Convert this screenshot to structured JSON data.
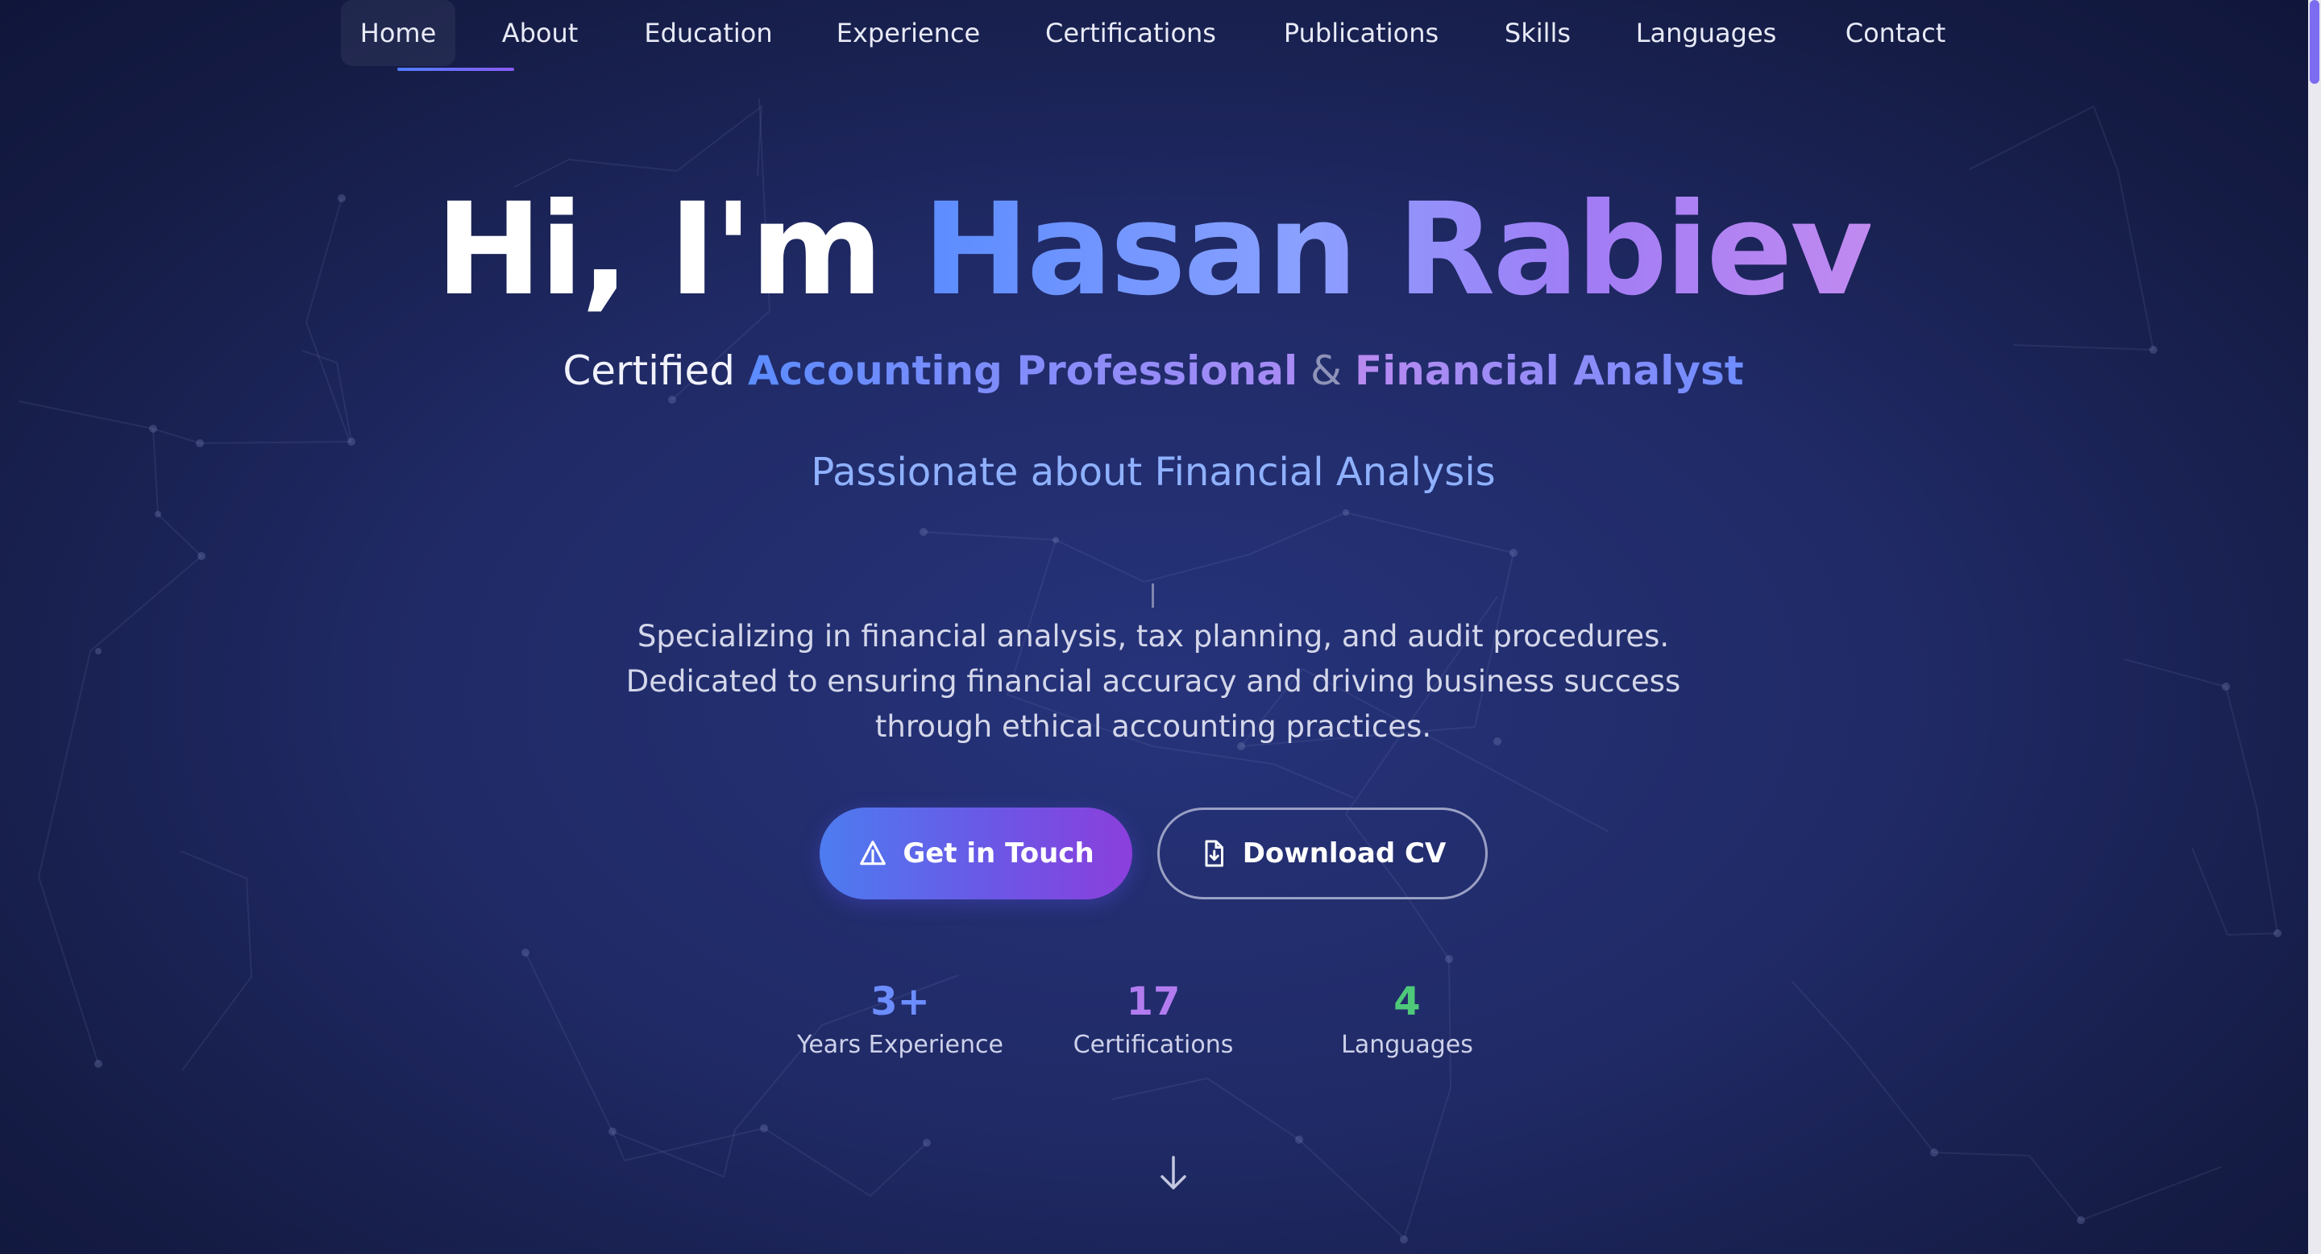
{
  "nav": {
    "items": [
      {
        "label": "Home",
        "active": true
      },
      {
        "label": "About"
      },
      {
        "label": "Education"
      },
      {
        "label": "Experience"
      },
      {
        "label": "Certifications"
      },
      {
        "label": "Publications"
      },
      {
        "label": "Skills"
      },
      {
        "label": "Languages"
      },
      {
        "label": "Contact"
      }
    ]
  },
  "hero": {
    "greeting": "Hi, I'm",
    "name": "Hasan Rabiev",
    "subtitle": {
      "prefix": "Certified",
      "role1": "Accounting Professional",
      "amp": "&",
      "role2": "Financial Analyst"
    },
    "tagline": "Passionate about Financial Analysis",
    "description": "Specializing in financial analysis, tax planning, and audit procedures. Dedicated to ensuring financial accuracy and driving business success through ethical accounting practices.",
    "buttons": {
      "primary": {
        "label": "Get in Touch",
        "icon": "send-icon"
      },
      "secondary": {
        "label": "Download CV",
        "icon": "file-download-icon"
      }
    }
  },
  "stats": [
    {
      "value": "3+",
      "label": "Years Experience",
      "color": "#6c8dff"
    },
    {
      "value": "17",
      "label": "Certifications",
      "color": "#b27cf0"
    },
    {
      "value": "4",
      "label": "Languages",
      "color": "#4ec97a"
    }
  ],
  "scroll_indicator": {
    "icon": "arrow-down-icon"
  },
  "colors": {
    "background": "#202a66",
    "accent_blue": "#5b8cff",
    "accent_purple": "#a17cf5",
    "tagline": "#8fb1ff",
    "scrollbar_thumb": "#7b6cf0"
  }
}
